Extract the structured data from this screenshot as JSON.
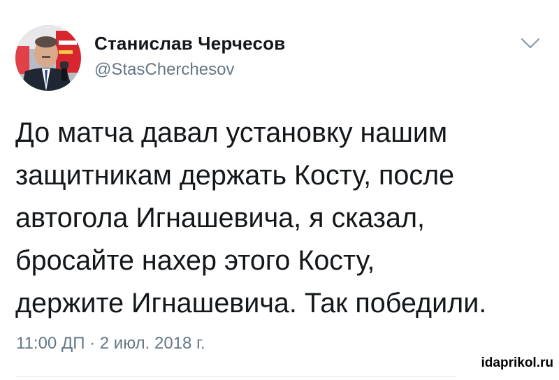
{
  "author": {
    "display_name": "Станислав Черчесов",
    "handle": "@StasCherchesov",
    "avatar_icon": "profile-photo-man-with-microphone"
  },
  "menu": {
    "caret_icon": "chevron-down-icon"
  },
  "tweet": {
    "text": "До матча давал установку нашим\nзащитникам держать Косту, после\nавтогола Игнашевича, я сказал,\nбросайте нахер этого Косту,\nдержите Игнашевича. Так победили.",
    "timestamp": "11:00 ДП · 2 июл. 2018 г."
  },
  "watermark": {
    "text": "idaprikol.ru"
  },
  "colors": {
    "text_primary": "#14171a",
    "text_secondary": "#657786",
    "divider": "#e1e8ed"
  }
}
